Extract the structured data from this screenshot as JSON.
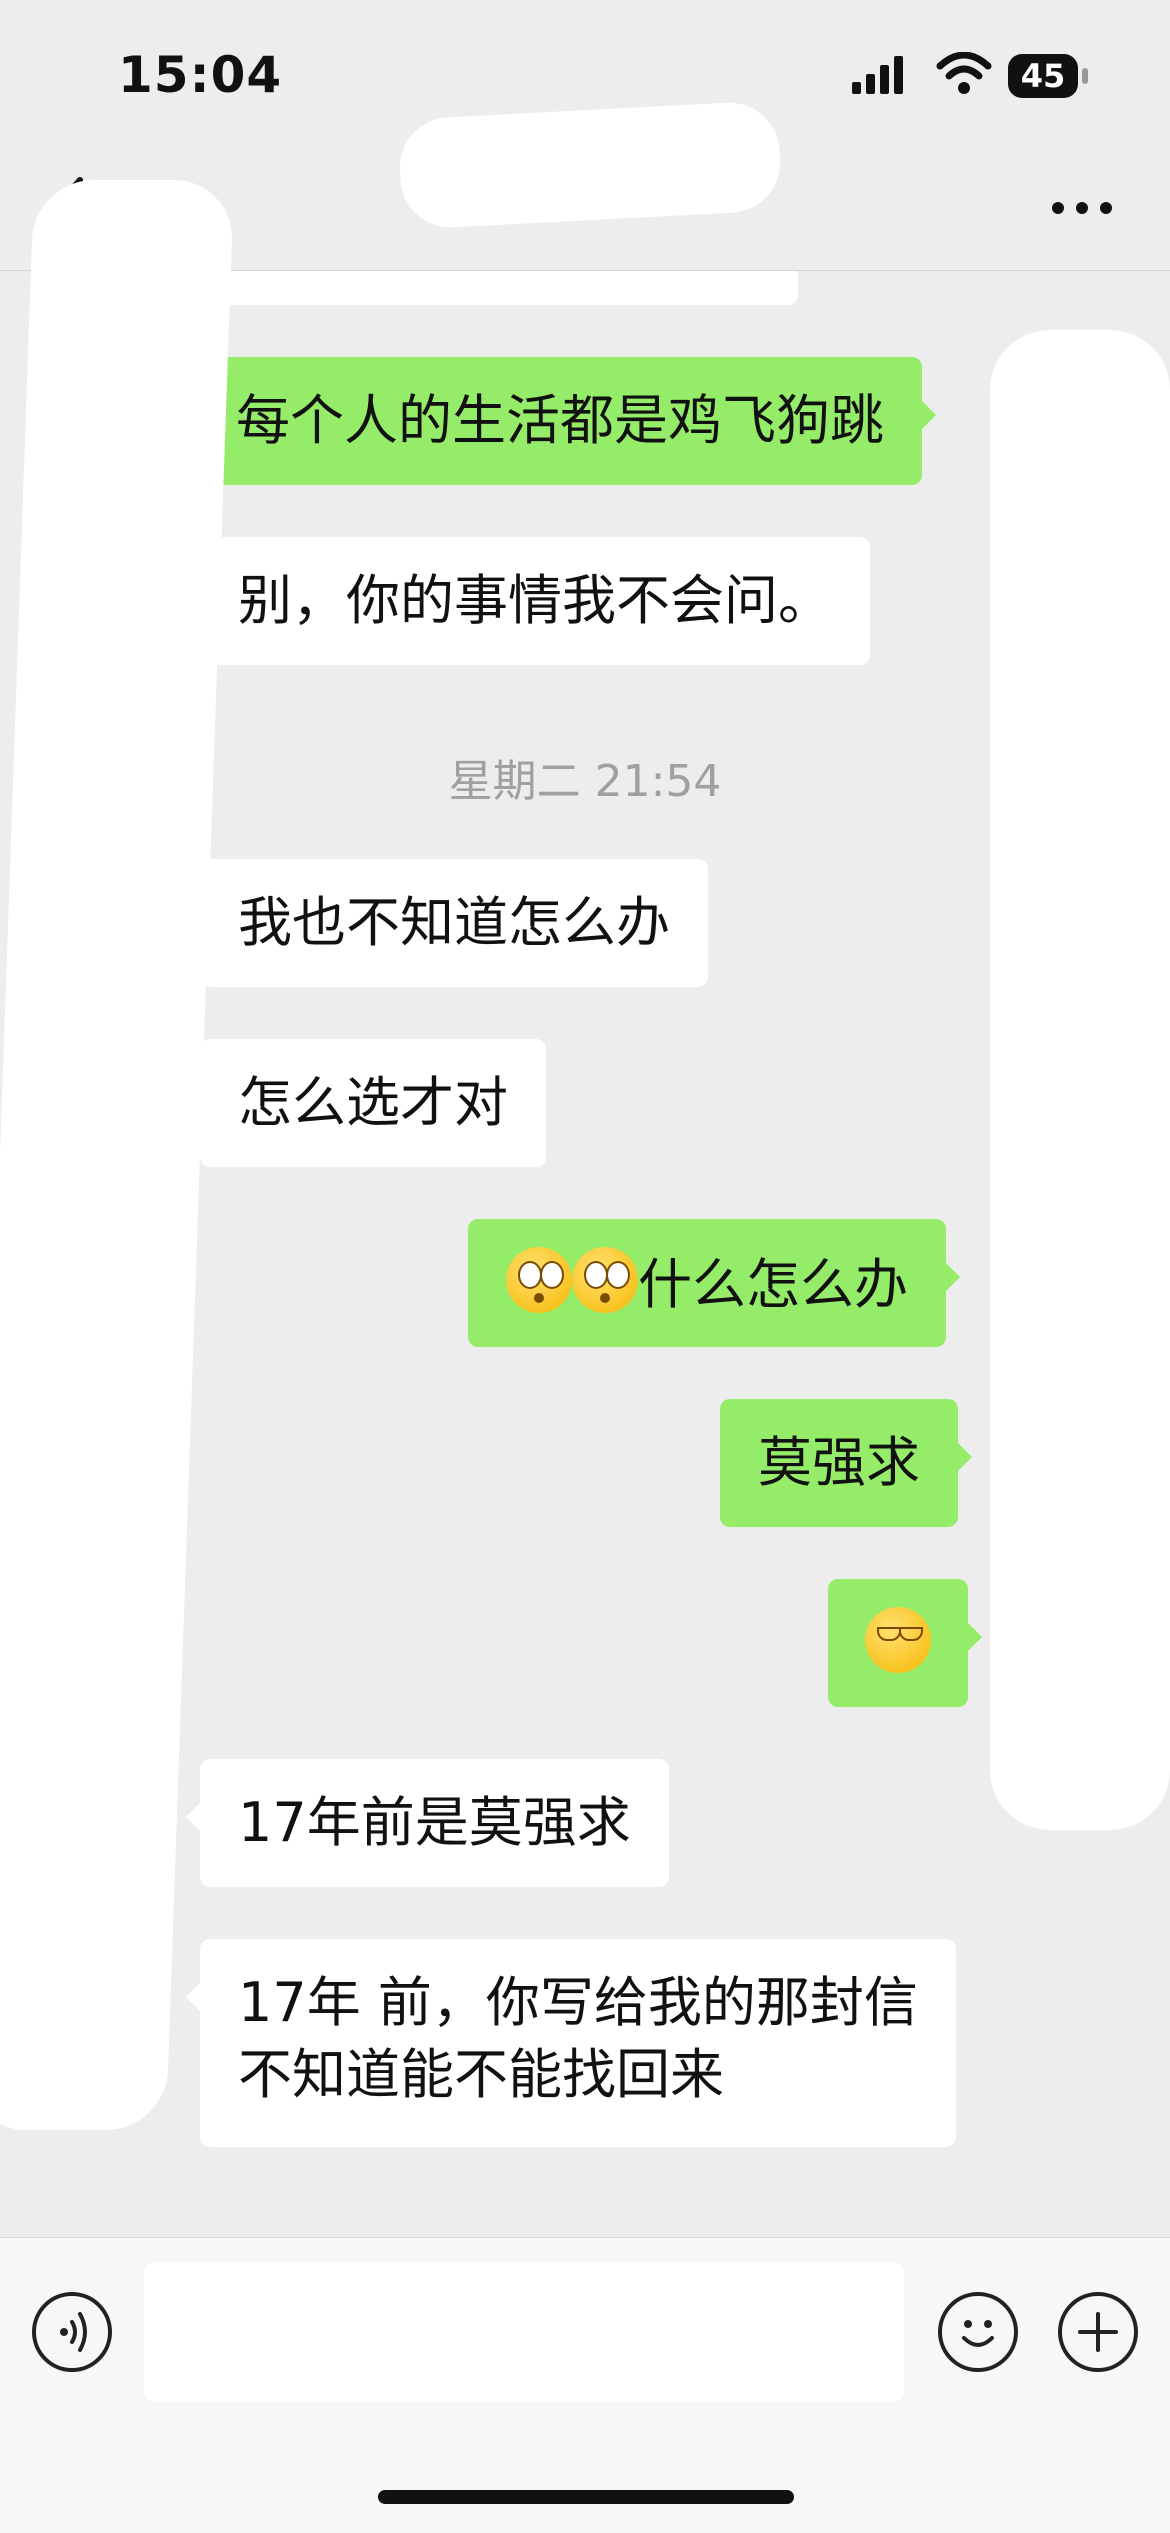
{
  "status": {
    "time": "15:04",
    "battery": "45"
  },
  "header": {
    "title": ""
  },
  "messages": {
    "m1": "每个人的生活都是鸡飞狗跳",
    "m2": "别，你的事情我不会问。",
    "stamp": "星期二 21:54",
    "m3": "我也不知道怎么办",
    "m4": "怎么选才对",
    "m5": "什么怎么办",
    "m6": "莫强求",
    "m8": "17年前是莫强求",
    "m9_line1": "17年 前，你写给我的那封信",
    "m9_line2": "不知道能不能找回来"
  },
  "icons": {
    "back": "chevron-left-icon",
    "more": "more-dots-icon",
    "voice": "voice-icon",
    "emoji": "emoji-icon",
    "plus": "plus-icon"
  },
  "colors": {
    "outgoing": "#95ec69",
    "incoming": "#ffffff",
    "background": "#ededed"
  }
}
